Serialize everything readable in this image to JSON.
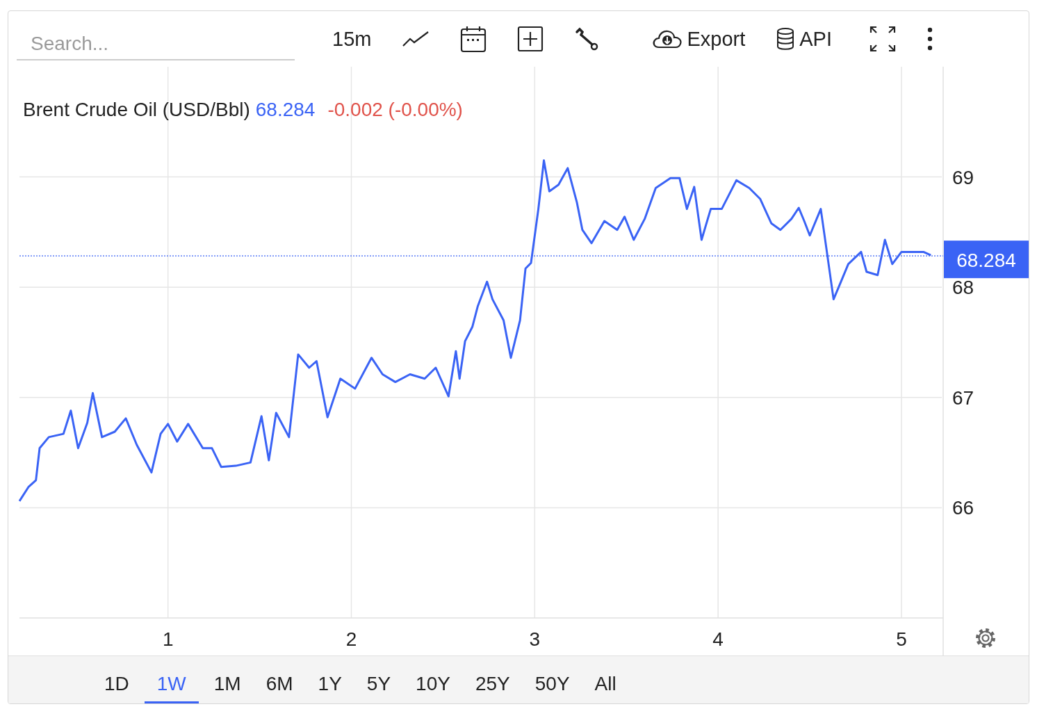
{
  "toolbar": {
    "search": {
      "placeholder": "Search..."
    },
    "interval": "15m",
    "export_label": "Export",
    "api_label": "API"
  },
  "chart": {
    "header": {
      "price": "68.284",
      "change": "-0.002 (-0.00%)"
    },
    "chart_data": {
      "type": "line",
      "x": [
        0.19,
        0.24,
        0.28,
        0.3,
        0.35,
        0.43,
        0.47,
        0.51,
        0.56,
        0.59,
        0.64,
        0.71,
        0.77,
        0.83,
        0.91,
        0.96,
        1.0,
        1.05,
        1.11,
        1.19,
        1.24,
        1.29,
        1.37,
        1.45,
        1.51,
        1.55,
        1.59,
        1.66,
        1.71,
        1.77,
        1.81,
        1.87,
        1.94,
        2.02,
        2.11,
        2.17,
        2.24,
        2.32,
        2.4,
        2.46,
        2.53,
        2.57,
        2.59,
        2.62,
        2.66,
        2.69,
        2.74,
        2.77,
        2.83,
        2.87,
        2.92,
        2.95,
        2.98,
        3.02,
        3.05,
        3.08,
        3.13,
        3.18,
        3.23,
        3.26,
        3.31,
        3.38,
        3.45,
        3.49,
        3.54,
        3.6,
        3.66,
        3.74,
        3.79,
        3.83,
        3.87,
        3.91,
        3.96,
        4.02,
        4.1,
        4.17,
        4.23,
        4.29,
        4.34,
        4.4,
        4.44,
        4.47,
        4.5,
        4.56,
        4.59,
        4.63,
        4.67,
        4.71,
        4.78,
        4.81,
        4.87,
        4.91,
        4.95,
        5.0,
        5.12,
        5.16
      ],
      "series": [
        {
          "name": "Brent Crude Oil (USD/Bbl)",
          "color": "#3a63f5",
          "values": [
            66.06,
            66.19,
            66.25,
            66.54,
            66.64,
            66.67,
            66.88,
            66.54,
            66.77,
            67.04,
            66.64,
            66.69,
            66.81,
            66.57,
            66.32,
            66.67,
            66.76,
            66.6,
            66.76,
            66.54,
            66.54,
            66.37,
            66.38,
            66.41,
            66.83,
            66.43,
            66.86,
            66.64,
            67.39,
            67.27,
            67.33,
            66.82,
            67.17,
            67.08,
            67.36,
            67.21,
            67.14,
            67.21,
            67.17,
            67.27,
            67.01,
            67.42,
            67.17,
            67.51,
            67.64,
            67.83,
            68.05,
            67.89,
            67.7,
            67.36,
            67.7,
            68.17,
            68.22,
            68.71,
            69.15,
            68.87,
            68.93,
            69.08,
            68.77,
            68.52,
            68.4,
            68.6,
            68.52,
            68.64,
            68.43,
            68.62,
            68.9,
            68.99,
            68.99,
            68.71,
            68.91,
            68.43,
            68.71,
            68.71,
            68.97,
            68.9,
            68.8,
            68.58,
            68.52,
            68.62,
            68.72,
            68.6,
            68.47,
            68.71,
            68.36,
            67.89,
            68.05,
            68.21,
            68.32,
            68.14,
            68.11,
            68.43,
            68.21,
            68.32,
            68.32,
            68.29
          ]
        }
      ],
      "xlim": [
        0.19,
        5.22
      ],
      "ylim": [
        65,
        70
      ],
      "xticks": [
        1,
        2,
        3,
        4,
        5
      ],
      "yticks": [
        66,
        67,
        68,
        69
      ],
      "grid": true,
      "ref_lines": [
        {
          "axis": "y",
          "value": 68.284,
          "label": "68.284",
          "color": "#3a63f5"
        }
      ]
    }
  },
  "ranges": [
    {
      "label": "1D",
      "selected": false
    },
    {
      "label": "1W",
      "selected": true
    },
    {
      "label": "1M",
      "selected": false
    },
    {
      "label": "6M",
      "selected": false
    },
    {
      "label": "1Y",
      "selected": false
    },
    {
      "label": "5Y",
      "selected": false
    },
    {
      "label": "10Y",
      "selected": false
    },
    {
      "label": "25Y",
      "selected": false
    },
    {
      "label": "50Y",
      "selected": false
    },
    {
      "label": "All",
      "selected": false
    }
  ]
}
